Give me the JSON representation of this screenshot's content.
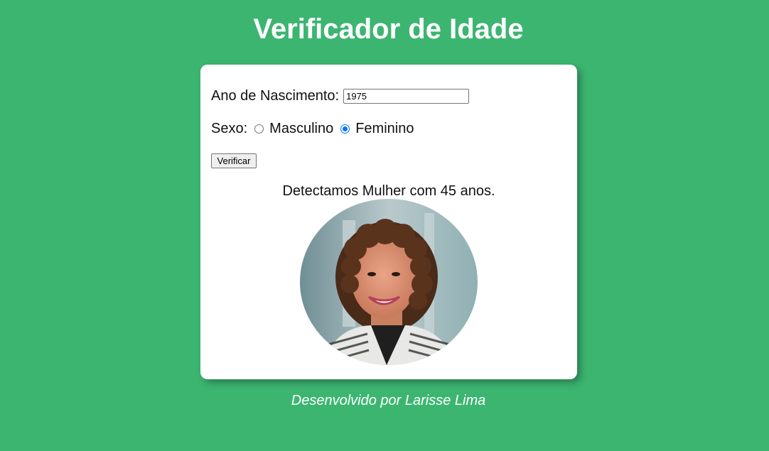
{
  "header": {
    "title": "Verificador de Idade"
  },
  "form": {
    "birth_year_label": "Ano de Nascimento:",
    "birth_year_value": "1975",
    "sex_label": "Sexo:",
    "sex_options": [
      {
        "label": "Masculino",
        "checked": false
      },
      {
        "label": "Feminino",
        "checked": true
      }
    ],
    "verify_button_label": "Verificar"
  },
  "result": {
    "text": "Detectamos Mulher com 45 anos.",
    "photo_icon": "woman-photo"
  },
  "footer": {
    "text": "Desenvolvido por Larisse Lima"
  },
  "colors": {
    "background": "#3cb571",
    "card": "#ffffff",
    "radio_accent": "#0075ff"
  }
}
